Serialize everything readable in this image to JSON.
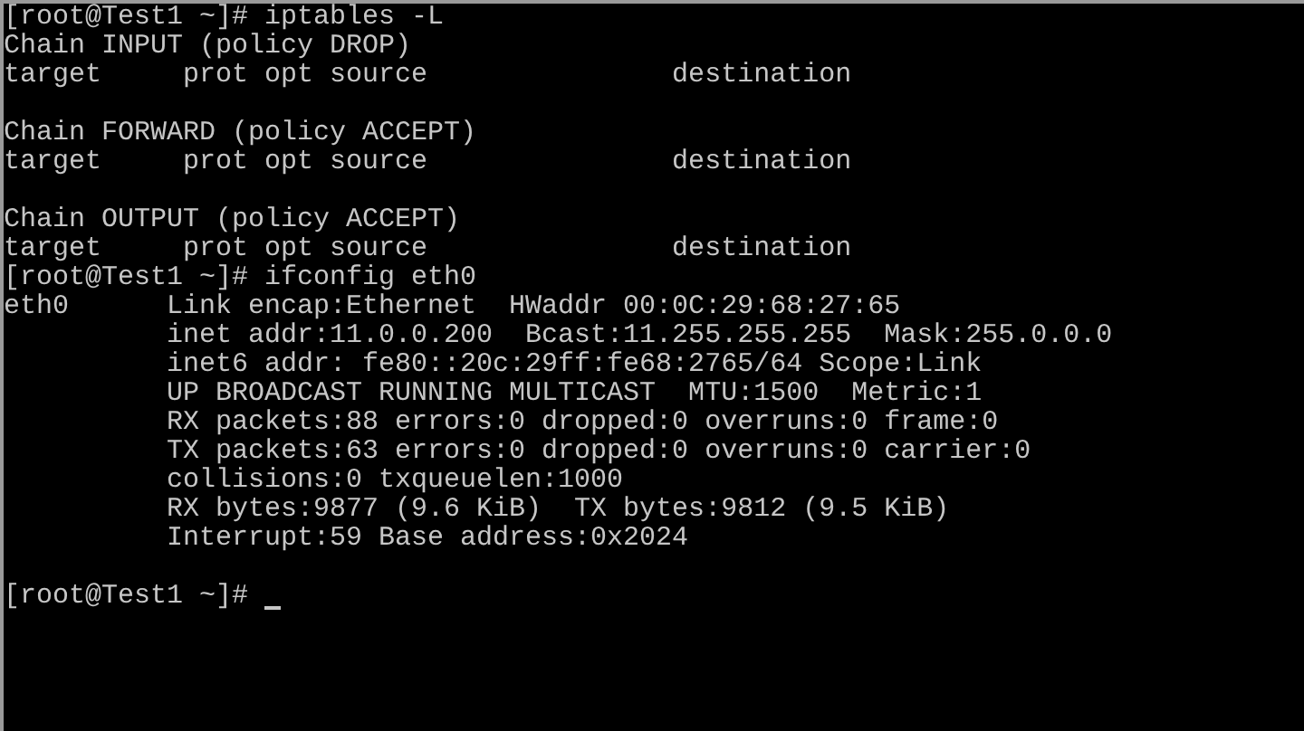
{
  "terminal": {
    "lines": [
      {
        "kind": "text",
        "text": "[root@Test1 ~]# iptables -L"
      },
      {
        "kind": "text",
        "text": "Chain INPUT (policy DROP)"
      },
      {
        "kind": "text",
        "text": "target     prot opt source               destination"
      },
      {
        "kind": "blank"
      },
      {
        "kind": "text",
        "text": "Chain FORWARD (policy ACCEPT)"
      },
      {
        "kind": "text",
        "text": "target     prot opt source               destination"
      },
      {
        "kind": "blank"
      },
      {
        "kind": "text",
        "text": "Chain OUTPUT (policy ACCEPT)"
      },
      {
        "kind": "text",
        "text": "target     prot opt source               destination"
      },
      {
        "kind": "text",
        "text": "[root@Test1 ~]# ifconfig eth0"
      },
      {
        "kind": "text",
        "text": "eth0      Link encap:Ethernet  HWaddr 00:0C:29:68:27:65"
      },
      {
        "kind": "text",
        "text": "          inet addr:11.0.0.200  Bcast:11.255.255.255  Mask:255.0.0.0"
      },
      {
        "kind": "text",
        "text": "          inet6 addr: fe80::20c:29ff:fe68:2765/64 Scope:Link"
      },
      {
        "kind": "text",
        "text": "          UP BROADCAST RUNNING MULTICAST  MTU:1500  Metric:1"
      },
      {
        "kind": "text",
        "text": "          RX packets:88 errors:0 dropped:0 overruns:0 frame:0"
      },
      {
        "kind": "text",
        "text": "          TX packets:63 errors:0 dropped:0 overruns:0 carrier:0"
      },
      {
        "kind": "text",
        "text": "          collisions:0 txqueuelen:1000"
      },
      {
        "kind": "text",
        "text": "          RX bytes:9877 (9.6 KiB)  TX bytes:9812 (9.5 KiB)"
      },
      {
        "kind": "text",
        "text": "          Interrupt:59 Base address:0x2024"
      },
      {
        "kind": "blank"
      },
      {
        "kind": "prompt",
        "text": "[root@Test1 ~]#",
        "cursor": true
      }
    ]
  }
}
